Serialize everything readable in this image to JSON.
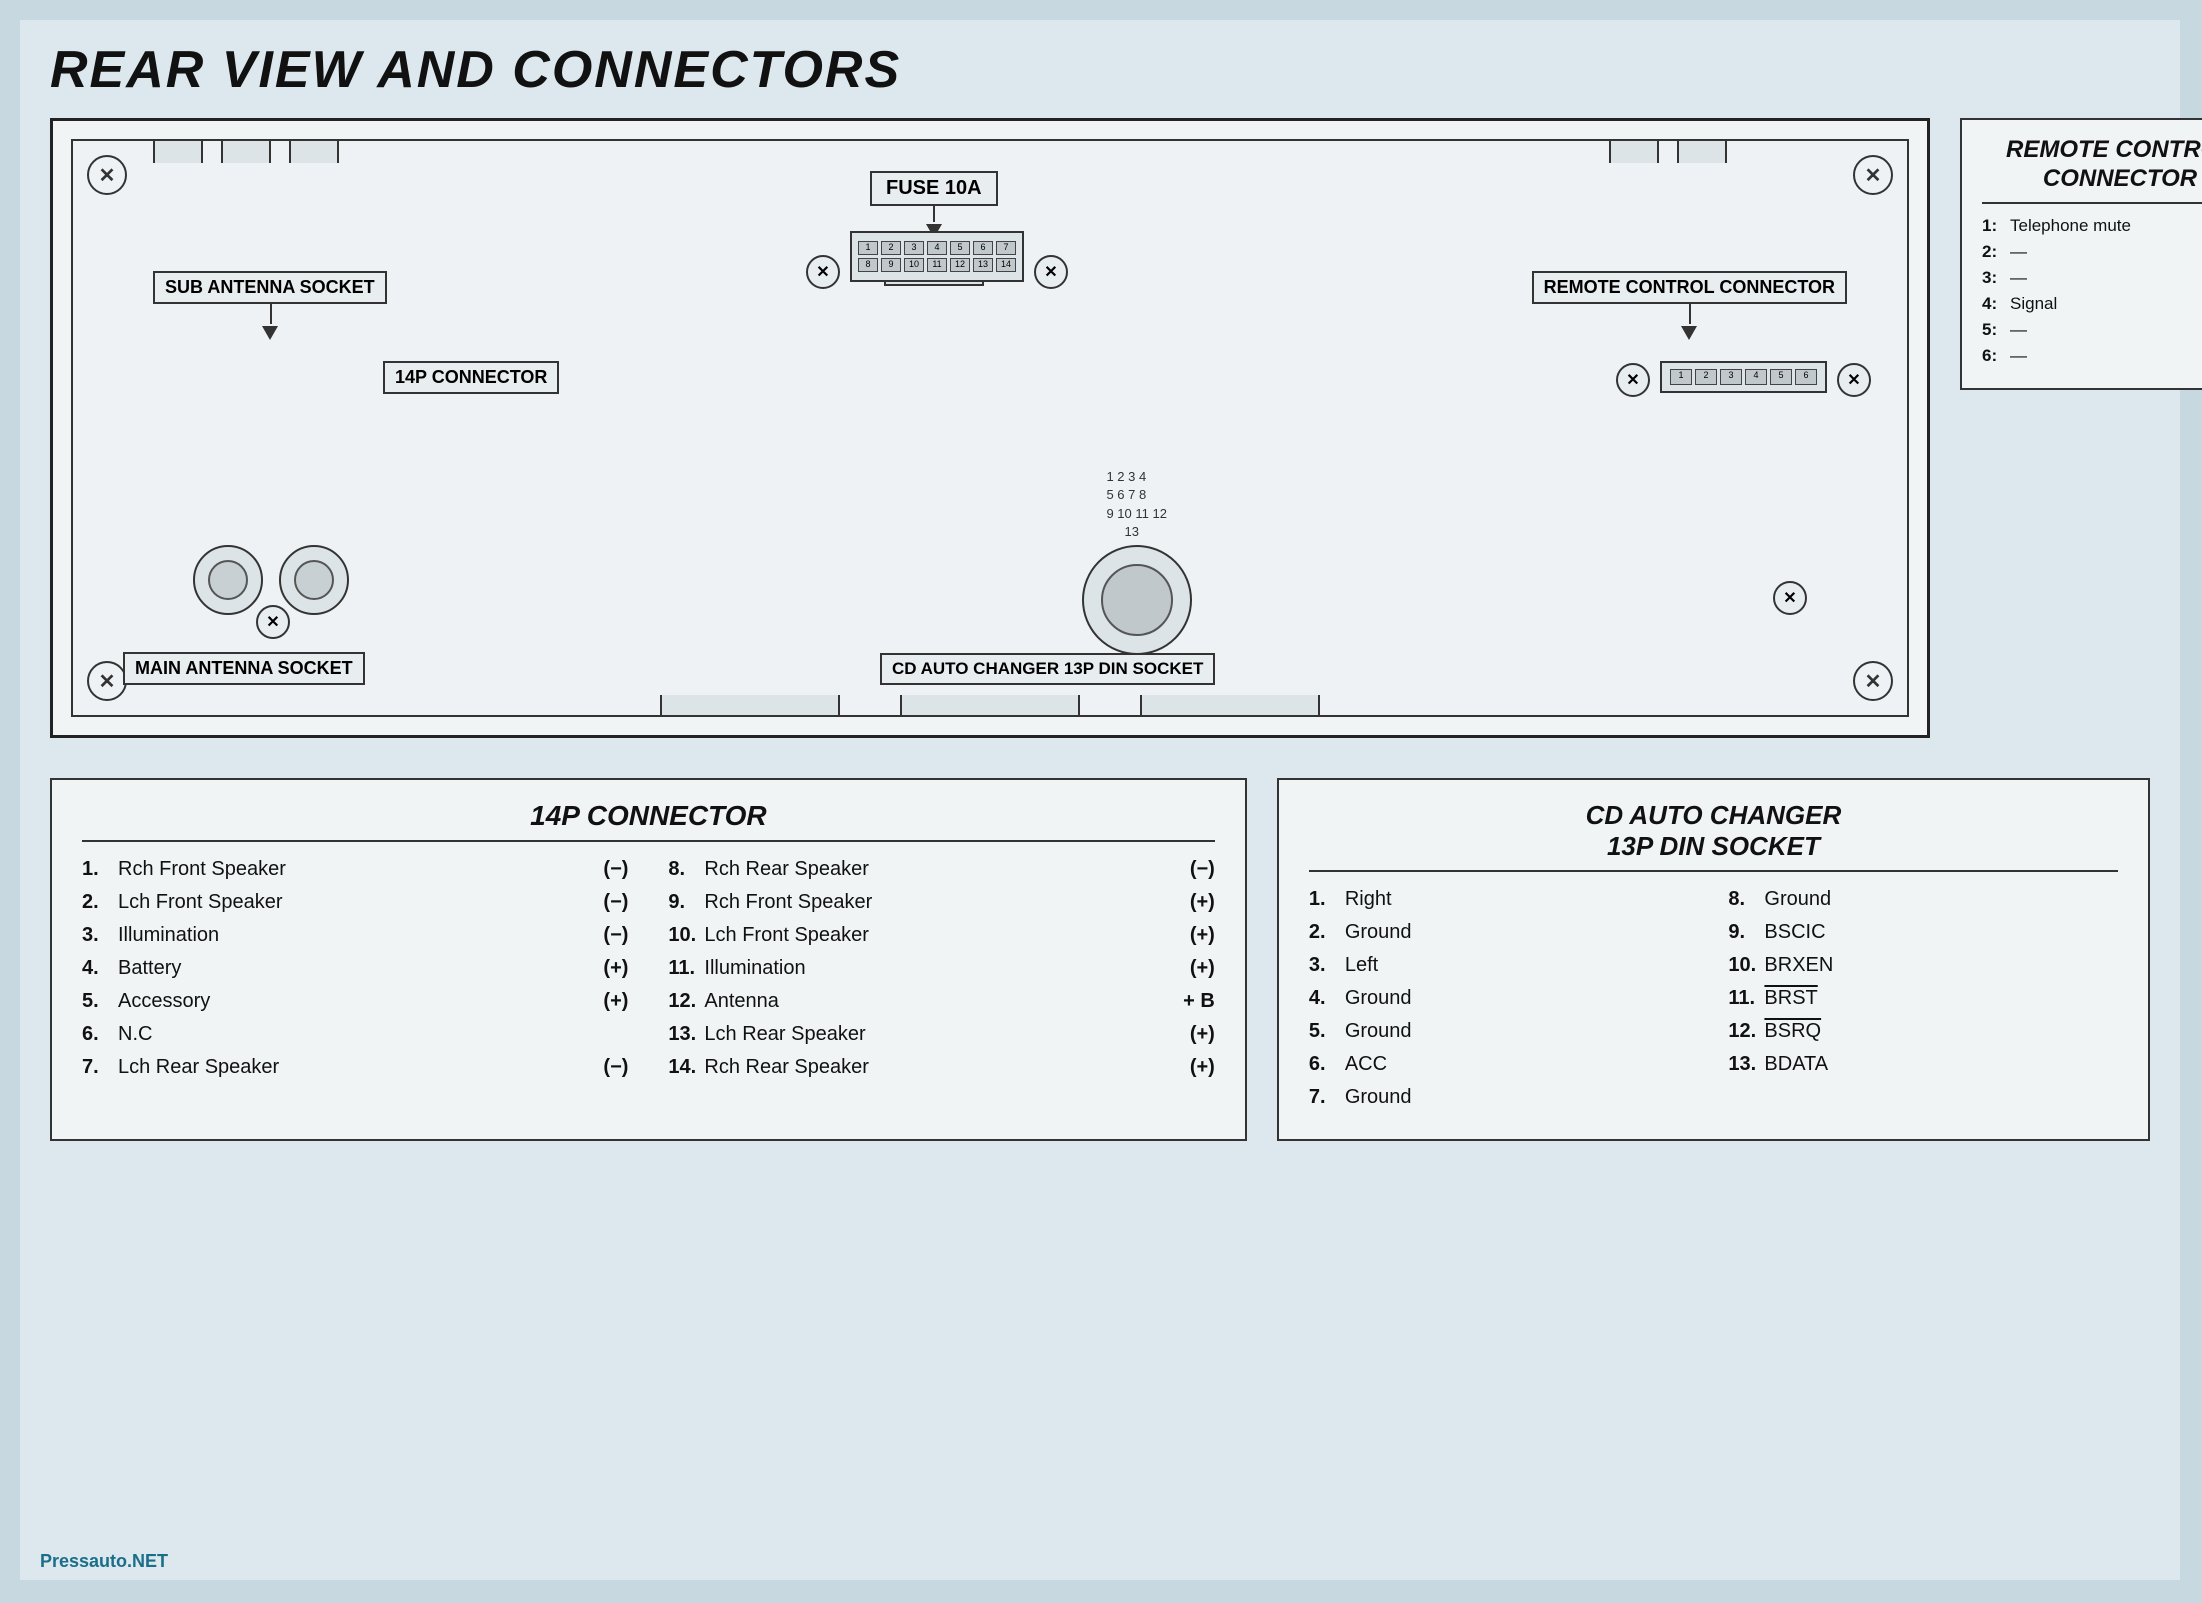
{
  "title": "REAR VIEW AND CONNECTORS",
  "diagram": {
    "labels": {
      "fuse": "FUSE 10A",
      "sub_antenna": "SUB ANTENNA SOCKET",
      "main_antenna": "MAIN ANTENNA SOCKET",
      "connector_14p": "14P CONNECTOR",
      "remote_control": "REMOTE CONTROL CONNECTOR",
      "cd_changer": "CD AUTO CHANGER 13P DIN SOCKET"
    }
  },
  "remote_control": {
    "title": "REMOTE CONTROL\nCONNECTOR",
    "items": [
      {
        "num": "1:",
        "label": "Telephone mute"
      },
      {
        "num": "2:",
        "label": "—"
      },
      {
        "num": "3:",
        "label": "—"
      },
      {
        "num": "4:",
        "label": "Signal"
      },
      {
        "num": "5:",
        "label": "—"
      },
      {
        "num": "6:",
        "label": "—"
      }
    ]
  },
  "connector_14p": {
    "title": "14P CONNECTOR",
    "left_items": [
      {
        "num": "1.",
        "label": "Rch Front Speaker",
        "sign": "(−)"
      },
      {
        "num": "2.",
        "label": "Lch Front Speaker",
        "sign": "(−)"
      },
      {
        "num": "3.",
        "label": "Illumination",
        "sign": "(−)"
      },
      {
        "num": "4.",
        "label": "Battery",
        "sign": "(+)"
      },
      {
        "num": "5.",
        "label": "Accessory",
        "sign": "(+)"
      },
      {
        "num": "6.",
        "label": "N.C",
        "sign": ""
      },
      {
        "num": "7.",
        "label": "Lch Rear Speaker",
        "sign": "(−)"
      }
    ],
    "right_items": [
      {
        "num": "8.",
        "label": "Rch Rear Speaker",
        "sign": "(−)"
      },
      {
        "num": "9.",
        "label": "Rch Front Speaker",
        "sign": "(+)"
      },
      {
        "num": "10.",
        "label": "Lch Front Speaker",
        "sign": "(+)"
      },
      {
        "num": "11.",
        "label": "Illumination",
        "sign": "(+)"
      },
      {
        "num": "12.",
        "label": "Antenna",
        "sign": "+ B"
      },
      {
        "num": "13.",
        "label": "Lch Rear Speaker",
        "sign": "(+)"
      },
      {
        "num": "14.",
        "label": "Rch Rear Speaker",
        "sign": "(+)"
      }
    ]
  },
  "cd_changer": {
    "title": "CD AUTO CHANGER\n13P DIN SOCKET",
    "left_items": [
      {
        "num": "1.",
        "label": "Right"
      },
      {
        "num": "2.",
        "label": "Ground"
      },
      {
        "num": "3.",
        "label": "Left"
      },
      {
        "num": "4.",
        "label": "Ground"
      },
      {
        "num": "5.",
        "label": "Ground"
      },
      {
        "num": "6.",
        "label": "ACC"
      },
      {
        "num": "7.",
        "label": "Ground"
      }
    ],
    "right_items": [
      {
        "num": "8.",
        "label": "Ground"
      },
      {
        "num": "9.",
        "label": "BSCIC"
      },
      {
        "num": "10.",
        "label": "BRXEN"
      },
      {
        "num": "11.",
        "label": "BRST",
        "overline": true
      },
      {
        "num": "12.",
        "label": "BSRQ",
        "overline": true
      },
      {
        "num": "13.",
        "label": "BDATA"
      }
    ]
  },
  "watermark": "Pressauto.NET",
  "colors": {
    "background": "#c8d8e0",
    "page_bg": "#dce8ed",
    "border": "#222222",
    "text": "#111111"
  }
}
